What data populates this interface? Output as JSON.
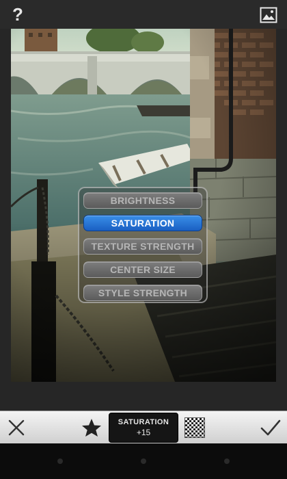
{
  "app": {
    "help_icon": "?",
    "icons": [
      "help-icon",
      "open-image-icon",
      "cancel-icon",
      "star-icon",
      "checkerboard-icon",
      "apply-checkmark-icon"
    ]
  },
  "menu": {
    "items": [
      {
        "label": "BRIGHTNESS",
        "selected": false
      },
      {
        "label": "SATURATION",
        "selected": true
      },
      {
        "label": "TEXTURE STRENGTH",
        "selected": false
      },
      {
        "label": "CENTER SIZE",
        "selected": false
      },
      {
        "label": "STYLE STRENGTH",
        "selected": false
      }
    ]
  },
  "toolbar": {
    "param_name": "SATURATION",
    "param_value": "+15"
  },
  "colors": {
    "accent": "#2a7fe0",
    "toolbar_bg": "#e6e6e6",
    "background": "#262626"
  }
}
